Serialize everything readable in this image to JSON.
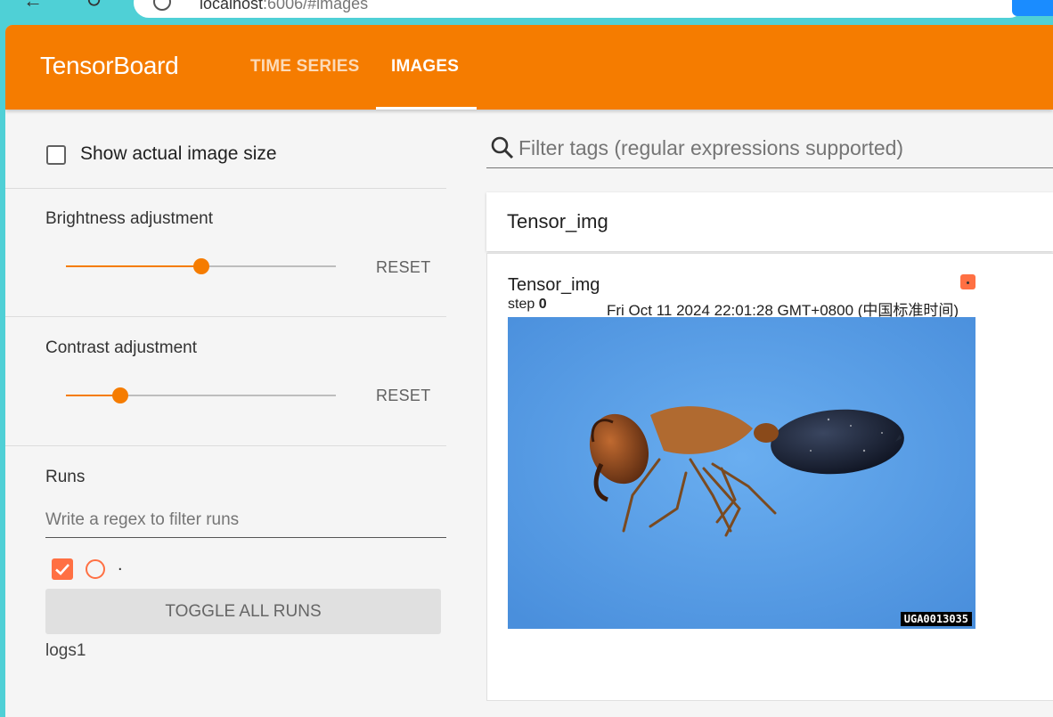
{
  "browser": {
    "url_host": "localhost",
    "url_rest": ":6006/#images"
  },
  "app": {
    "brand": "TensorBoard",
    "tabs": [
      {
        "label": "TIME SERIES",
        "active": false
      },
      {
        "label": "IMAGES",
        "active": true
      }
    ],
    "accent_color": "#f57c00"
  },
  "sidebar": {
    "show_actual_size_label": "Show actual image size",
    "show_actual_size_checked": false,
    "brightness": {
      "label": "Brightness adjustment",
      "reset_label": "RESET",
      "value_fraction": 0.5
    },
    "contrast": {
      "label": "Contrast adjustment",
      "reset_label": "RESET",
      "value_fraction": 0.2
    },
    "runs": {
      "title": "Runs",
      "filter_placeholder": "Write a regex to filter runs",
      "items": [
        {
          "name": ".",
          "checked": true,
          "color": "#ff7043"
        }
      ],
      "toggle_all_label": "TOGGLE ALL RUNS",
      "logdir": "logs1"
    }
  },
  "main": {
    "filter_placeholder": "Filter tags (regular expressions supported)",
    "card_header_title": "Tensor_img",
    "image_card": {
      "title": "Tensor_img",
      "step_label": "step",
      "step_value": "0",
      "timestamp": "Fri Oct 11 2024 22:01:28 GMT+0800 (中国标准时间)",
      "watermark": "UGA0013035"
    }
  }
}
